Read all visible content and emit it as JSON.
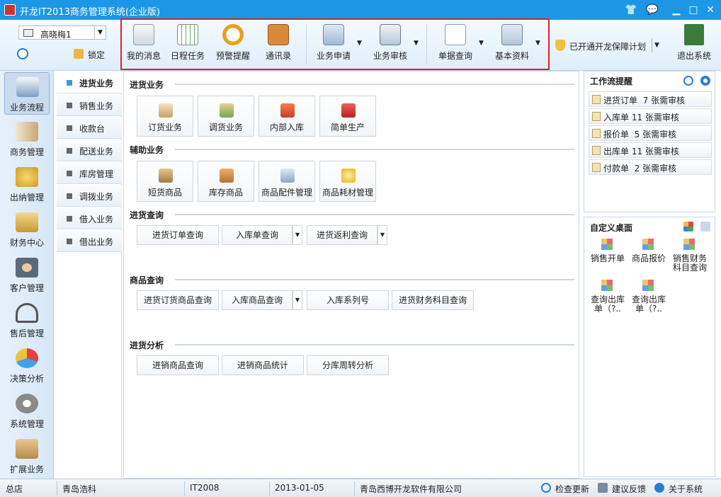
{
  "window": {
    "title": "开龙IT2013商务管理系统(企业版)",
    "controls": [
      "shirt-icon",
      "chat-icon",
      "minimize-icon",
      "maximize-icon",
      "close-icon"
    ]
  },
  "user": {
    "name": "高晓梅1",
    "lock_label": "锁定"
  },
  "toolbar": {
    "items": [
      {
        "label": "我的消息",
        "icon": "message-envelope-icon"
      },
      {
        "label": "日程任务",
        "icon": "calendar-icon"
      },
      {
        "label": "预警提醒",
        "icon": "alarm-clock-icon"
      },
      {
        "label": "通讯录",
        "icon": "address-book-icon"
      },
      {
        "label": "业务申请",
        "icon": "org-chart-icon"
      },
      {
        "label": "业务审核",
        "icon": "stamp-icon"
      },
      {
        "label": "单据查询",
        "icon": "document-search-icon"
      },
      {
        "label": "基本资料",
        "icon": "notebook-search-icon"
      }
    ],
    "guarantee_label": "已开通开龙保障计划",
    "exit_label": "退出系统"
  },
  "leftnav": {
    "items": [
      {
        "label": "业务流程",
        "icon": "truck-icon"
      },
      {
        "label": "商务管理",
        "icon": "book-icon"
      },
      {
        "label": "出纳管理",
        "icon": "coins-icon"
      },
      {
        "label": "财务中心",
        "icon": "scale-icon"
      },
      {
        "label": "客户管理",
        "icon": "people-icon"
      },
      {
        "label": "售后管理",
        "icon": "headset-icon"
      },
      {
        "label": "决策分析",
        "icon": "pie-chart-icon"
      },
      {
        "label": "系统管理",
        "icon": "gears-icon"
      },
      {
        "label": "扩展业务",
        "icon": "box-icon"
      }
    ]
  },
  "subnav": {
    "items": [
      "进货业务",
      "销售业务",
      "收款台",
      "配送业务",
      "库房管理",
      "调拨业务",
      "借入业务",
      "借出业务"
    ]
  },
  "main": {
    "sections": {
      "purchase": {
        "title": "进货业务",
        "buttons": [
          "订货业务",
          "调货业务",
          "内部入库",
          "简单生产"
        ]
      },
      "aux": {
        "title": "辅助业务",
        "buttons": [
          "短货商品",
          "库存商品",
          "商品配件管理",
          "商品耗材管理"
        ]
      },
      "purchase_query": {
        "title": "进货查询",
        "buttons": [
          "进货订单查询",
          "入库单查询",
          "进货返利查询"
        ]
      },
      "goods_query": {
        "title": "商品查询",
        "buttons": [
          "进货订货商品查询",
          "入库商品查询",
          "入库系列号",
          "进货财务科目查询"
        ]
      },
      "analysis": {
        "title": "进货分析",
        "buttons": [
          "进销商品查询",
          "进销商品统计",
          "分库周转分析"
        ]
      }
    }
  },
  "workflow": {
    "title": "工作流提醒",
    "items": [
      "进货订单  7 张需审核",
      "入库单 11 张需审核",
      "报价单  5 张需审核",
      "出库单 11 张需审核",
      "付款单  2 张需审核"
    ]
  },
  "desktop": {
    "title": "自定义桌面",
    "items": [
      [
        "销售开单"
      ],
      [
        "商品报价"
      ],
      [
        "销售财务",
        "科目查询"
      ],
      [
        "查询出库",
        "单（?.."
      ],
      [
        "查询出库",
        "单（?.."
      ]
    ]
  },
  "status": {
    "store": "总店",
    "user_company": "青岛浩科",
    "version": "IT2008",
    "date": "2013-01-05",
    "vendor": "青岛西博开龙软件有限公司",
    "check_update": "检查更新",
    "feedback": "建议反馈",
    "about": "关于系统"
  },
  "colors": {
    "titlebar": "#1b97e6",
    "highlight_frame": "#e0202a",
    "active_bullet": "#3a98e0"
  }
}
